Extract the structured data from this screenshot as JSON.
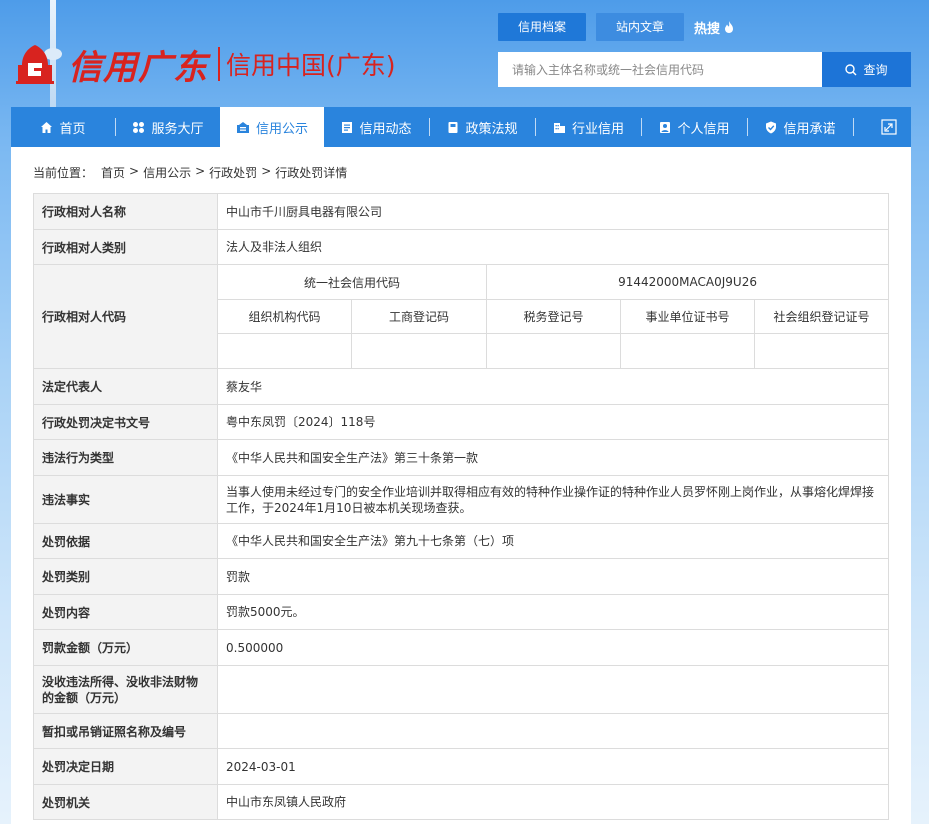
{
  "header": {
    "logo_script": "信用广东",
    "logo_text": "信用中国(广东)",
    "top_tabs": [
      {
        "label": "信用档案",
        "active": true
      },
      {
        "label": "站内文章",
        "active": false
      }
    ],
    "hot_label": "热搜",
    "search_placeholder": "请输入主体名称或统一社会信用代码",
    "search_button": "查询"
  },
  "nav": {
    "items": [
      {
        "label": "首页",
        "icon": "home-icon",
        "active": false
      },
      {
        "label": "服务大厅",
        "icon": "grid-icon",
        "active": false
      },
      {
        "label": "信用公示",
        "icon": "notice-icon",
        "active": true
      },
      {
        "label": "信用动态",
        "icon": "news-icon",
        "active": false
      },
      {
        "label": "政策法规",
        "icon": "book-icon",
        "active": false
      },
      {
        "label": "行业信用",
        "icon": "building-icon",
        "active": false
      },
      {
        "label": "个人信用",
        "icon": "person-icon",
        "active": false
      },
      {
        "label": "信用承诺",
        "icon": "shield-icon",
        "active": false
      }
    ]
  },
  "breadcrumb": {
    "prefix": "当前位置：",
    "items": [
      "首页",
      "信用公示",
      "行政处罚",
      "行政处罚详情"
    ],
    "separator": ">"
  },
  "detail": {
    "name_label": "行政相对人名称",
    "name_value": "中山市千川厨具电器有限公司",
    "type_label": "行政相对人类别",
    "type_value": "法人及非法人组织",
    "code_label": "行政相对人代码",
    "uscc_label": "统一社会信用代码",
    "uscc_value": "91442000MACA0J9U26",
    "sub_headers": [
      "组织机构代码",
      "工商登记码",
      "税务登记号",
      "事业单位证书号",
      "社会组织登记证号"
    ],
    "sub_values": [
      "",
      "",
      "",
      "",
      ""
    ],
    "legal_rep_label": "法定代表人",
    "legal_rep_value": "蔡友华",
    "doc_no_label": "行政处罚决定书文号",
    "doc_no_value": "粤中东凤罚〔2024〕118号",
    "violation_type_label": "违法行为类型",
    "violation_type_value": "《中华人民共和国安全生产法》第三十条第一款",
    "facts_label": "违法事实",
    "facts_value": "当事人使用未经过专门的安全作业培训并取得相应有效的特种作业操作证的特种作业人员罗怀刚上岗作业，从事熔化焊焊接工作，于2024年1月10日被本机关现场查获。",
    "basis_label": "处罚依据",
    "basis_value": "《中华人民共和国安全生产法》第九十七条第（七）项",
    "category_label": "处罚类别",
    "category_value": "罚款",
    "content_label": "处罚内容",
    "content_value": "罚款5000元。",
    "fine_label": "罚款金额（万元）",
    "fine_value": "0.500000",
    "confiscation_label": "没收违法所得、没收非法财物的金额（万元）",
    "confiscation_value": "",
    "license_label": "暂扣或吊销证照名称及编号",
    "license_value": "",
    "date_label": "处罚决定日期",
    "date_value": "2024-03-01",
    "authority_label": "处罚机关",
    "authority_value": "中山市东凤镇人民政府"
  }
}
